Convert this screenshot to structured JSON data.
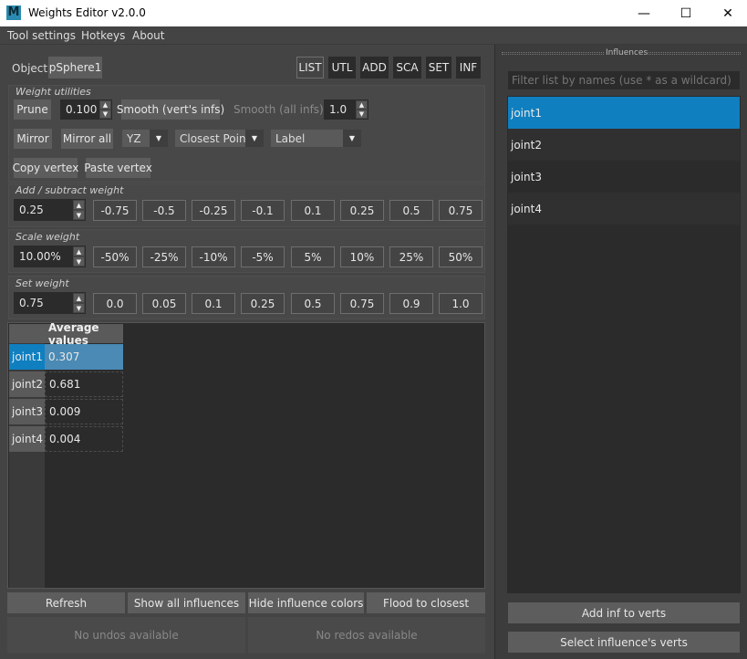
{
  "window": {
    "title": "Weights Editor v2.0.0",
    "icon": "M",
    "minimize": "—",
    "maximize": "☐",
    "close": "✕"
  },
  "menu": [
    "Tool settings",
    "Hotkeys",
    "About"
  ],
  "object": {
    "label": "Object:",
    "name": "pSphere1"
  },
  "modes": [
    "LIST",
    "UTL",
    "ADD",
    "SCA",
    "SET",
    "INF"
  ],
  "weight_utilities": {
    "title": "Weight utilities",
    "prune_label": "Prune",
    "prune_value": "0.100",
    "smooth_label": "Smooth (vert's infs)",
    "smooth_all_label": "Smooth (all infs)",
    "smooth_value": "1.0",
    "mirror_label": "Mirror",
    "mirror_all_label": "Mirror all",
    "axis_option": "YZ",
    "mode_option": "Closest Point",
    "label_option": "Label",
    "copy_label": "Copy vertex",
    "paste_label": "Paste vertex"
  },
  "add_weight": {
    "title": "Add / subtract weight",
    "value": "0.25",
    "buttons": [
      "-0.75",
      "-0.5",
      "-0.25",
      "-0.1",
      "0.1",
      "0.25",
      "0.5",
      "0.75"
    ]
  },
  "scale_weight": {
    "title": "Scale weight",
    "value": "10.00%",
    "buttons": [
      "-50%",
      "-25%",
      "-10%",
      "-5%",
      "5%",
      "10%",
      "25%",
      "50%"
    ]
  },
  "set_weight": {
    "title": "Set weight",
    "value": "0.75",
    "buttons": [
      "0.0",
      "0.05",
      "0.1",
      "0.25",
      "0.5",
      "0.75",
      "0.9",
      "1.0"
    ]
  },
  "table": {
    "header": "Average values",
    "rows": [
      {
        "joint": "joint1",
        "value": "0.307",
        "selected": true
      },
      {
        "joint": "joint2",
        "value": "0.681",
        "selected": false
      },
      {
        "joint": "joint3",
        "value": "0.009",
        "selected": false
      },
      {
        "joint": "joint4",
        "value": "0.004",
        "selected": false
      }
    ]
  },
  "bottom_buttons": [
    "Refresh",
    "Show all influences",
    "Hide influence colors",
    "Flood to closest"
  ],
  "undo": {
    "undo_label": "No undos available",
    "redo_label": "No redos available"
  },
  "influences": {
    "title": "Influences",
    "filter_placeholder": "Filter list by names (use * as a wildcard)",
    "items": [
      "joint1",
      "joint2",
      "joint3",
      "joint4"
    ],
    "add_label": "Add inf to verts",
    "select_label": "Select influence's verts"
  },
  "colors": {
    "accent": "#0f7fc0",
    "selected_cell": "#4a8ab5"
  }
}
